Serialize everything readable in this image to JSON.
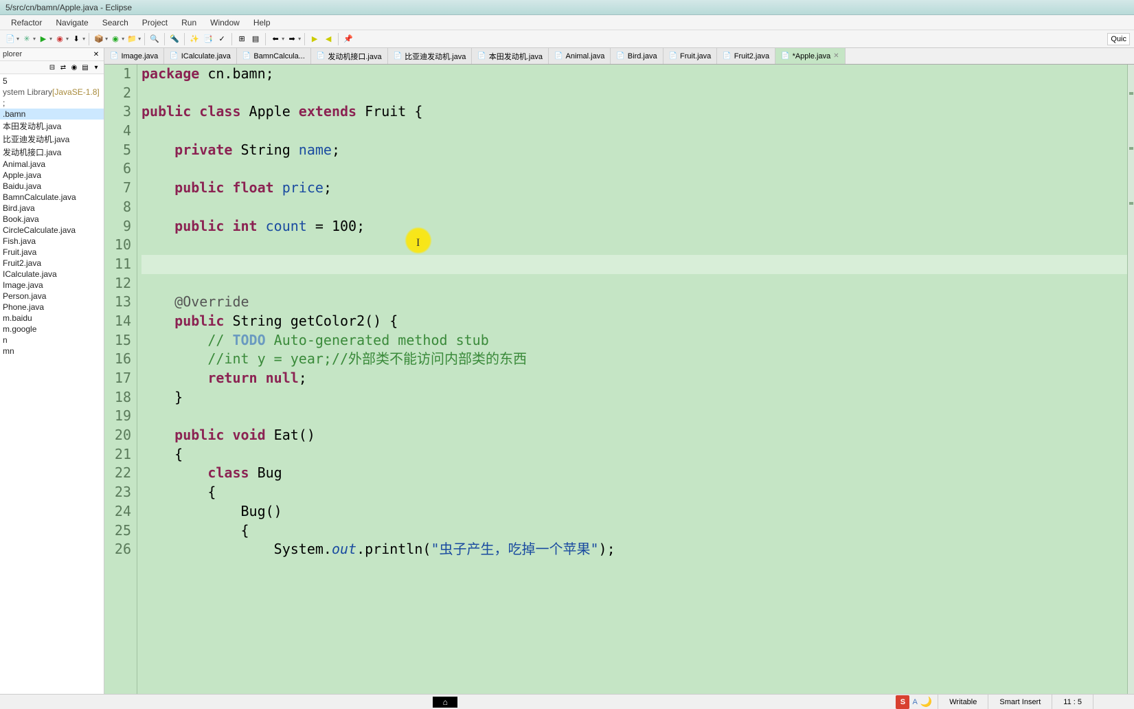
{
  "window": {
    "title": "5/src/cn/bamn/Apple.java - Eclipse"
  },
  "menu": [
    "Refactor",
    "Navigate",
    "Search",
    "Project",
    "Run",
    "Window",
    "Help"
  ],
  "quick": "Quic",
  "sidebar": {
    "panel_title": "plorer",
    "lib_label": "ystem Library ",
    "lib_version": "[JavaSE-1.8]",
    "selected": ".bamn",
    "items": [
      "本田发动机.java",
      "比亚迪发动机.java",
      "发动机接口.java",
      "Animal.java",
      "Apple.java",
      "Baidu.java",
      "BamnCalculate.java",
      "Bird.java",
      "Book.java",
      "CircleCalculate.java",
      "Fish.java",
      "Fruit.java",
      "Fruit2.java",
      "ICalculate.java",
      "Image.java",
      "Person.java",
      "Phone.java",
      "m.baidu",
      "m.google",
      "n",
      "mn"
    ]
  },
  "tabs": [
    {
      "label": "Image.java",
      "dirty": false
    },
    {
      "label": "ICalculate.java",
      "dirty": false
    },
    {
      "label": "BamnCalcula...",
      "dirty": false
    },
    {
      "label": "发动机接口.java",
      "dirty": false
    },
    {
      "label": "比亚迪发动机.java",
      "dirty": false
    },
    {
      "label": "本田发动机.java",
      "dirty": false
    },
    {
      "label": "Animal.java",
      "dirty": false
    },
    {
      "label": "Bird.java",
      "dirty": false
    },
    {
      "label": "Fruit.java",
      "dirty": false
    },
    {
      "label": "Fruit2.java",
      "dirty": false
    },
    {
      "label": "*Apple.java",
      "dirty": true,
      "active": true
    }
  ],
  "code_lines": {
    "1": [
      {
        "t": "package ",
        "c": "kw"
      },
      {
        "t": "cn.bamn;",
        "c": ""
      }
    ],
    "2": [],
    "3": [
      {
        "t": "public class ",
        "c": "kw"
      },
      {
        "t": "Apple ",
        "c": ""
      },
      {
        "t": "extends ",
        "c": "kw"
      },
      {
        "t": "Fruit {",
        "c": ""
      }
    ],
    "4": [],
    "5": [
      {
        "t": "    ",
        "c": ""
      },
      {
        "t": "private ",
        "c": "kw"
      },
      {
        "t": "String ",
        "c": ""
      },
      {
        "t": "name",
        "c": "field"
      },
      {
        "t": ";",
        "c": ""
      }
    ],
    "6": [],
    "7": [
      {
        "t": "    ",
        "c": ""
      },
      {
        "t": "public float ",
        "c": "kw"
      },
      {
        "t": "price",
        "c": "field"
      },
      {
        "t": ";",
        "c": ""
      }
    ],
    "8": [],
    "9": [
      {
        "t": "    ",
        "c": ""
      },
      {
        "t": "public int ",
        "c": "kw"
      },
      {
        "t": "count",
        "c": "field"
      },
      {
        "t": " = 100;",
        "c": ""
      }
    ],
    "10": [],
    "11": [
      {
        "t": "    ",
        "c": ""
      }
    ],
    "12": [],
    "13": [
      {
        "t": "    @Override",
        "c": "ann"
      }
    ],
    "14": [
      {
        "t": "    ",
        "c": ""
      },
      {
        "t": "public ",
        "c": "kw"
      },
      {
        "t": "String getColor2() {",
        "c": ""
      }
    ],
    "15": [
      {
        "t": "        ",
        "c": ""
      },
      {
        "t": "// ",
        "c": "comment"
      },
      {
        "t": "TODO",
        "c": "todo"
      },
      {
        "t": " Auto-generated method stub",
        "c": "comment"
      }
    ],
    "16": [
      {
        "t": "        ",
        "c": ""
      },
      {
        "t": "//",
        "c": "comment"
      },
      {
        "t": "int",
        "c": "comment"
      },
      {
        "t": " y = year;",
        "c": "comment"
      },
      {
        "t": "//外部类不能访问内部类的东西",
        "c": "comment"
      }
    ],
    "17": [
      {
        "t": "        ",
        "c": ""
      },
      {
        "t": "return null",
        "c": "kw"
      },
      {
        "t": ";",
        "c": ""
      }
    ],
    "18": [
      {
        "t": "    }",
        "c": ""
      }
    ],
    "19": [],
    "20": [
      {
        "t": "    ",
        "c": ""
      },
      {
        "t": "public void ",
        "c": "kw"
      },
      {
        "t": "Eat()",
        "c": ""
      }
    ],
    "21": [
      {
        "t": "    {",
        "c": ""
      }
    ],
    "22": [
      {
        "t": "        ",
        "c": ""
      },
      {
        "t": "class ",
        "c": "kw"
      },
      {
        "t": "Bug",
        "c": ""
      }
    ],
    "23": [
      {
        "t": "        {",
        "c": ""
      }
    ],
    "24": [
      {
        "t": "            Bug()",
        "c": ""
      }
    ],
    "25": [
      {
        "t": "            {",
        "c": ""
      }
    ],
    "26": [
      {
        "t": "                System.",
        "c": ""
      },
      {
        "t": "out",
        "c": "field italic"
      },
      {
        "t": ".println(",
        "c": ""
      },
      {
        "t": "\"虫子产生，吃掉一个苹果\"",
        "c": "str"
      },
      {
        "t": ");",
        "c": ""
      }
    ]
  },
  "status": {
    "writable": "Writable",
    "insert": "Smart Insert",
    "pos": "11 : 5",
    "ime": "S",
    "a": "A"
  }
}
